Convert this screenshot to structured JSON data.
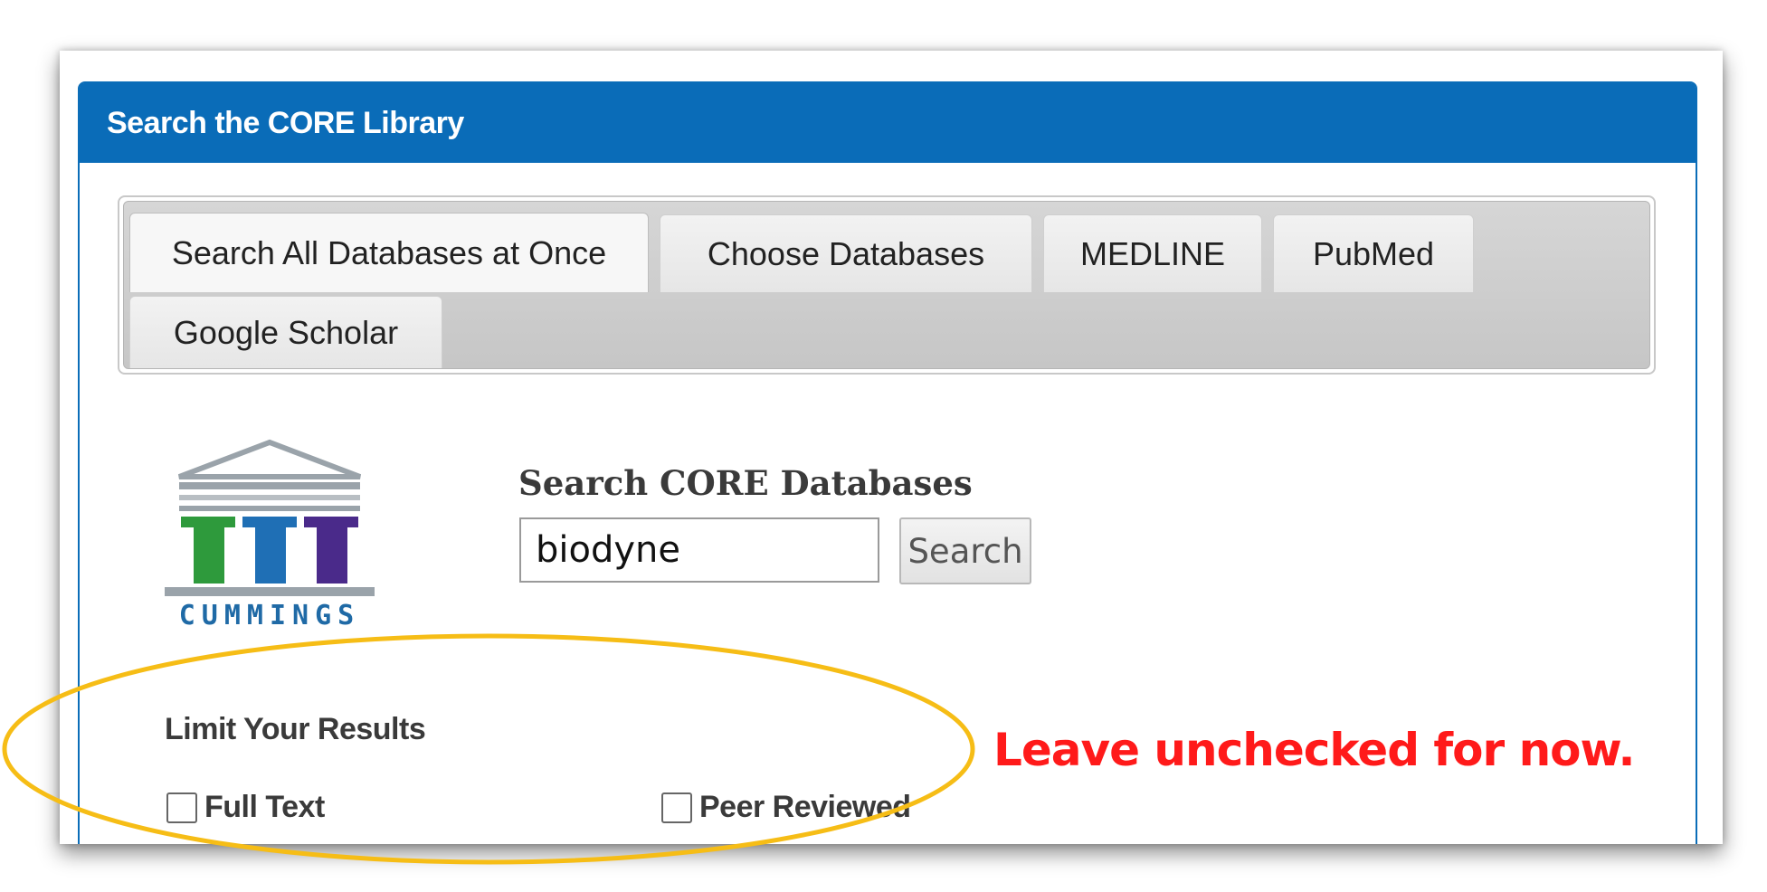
{
  "panel": {
    "title": "Search the CORE Library"
  },
  "tabs": [
    {
      "label": "Search All Databases at Once",
      "active": true
    },
    {
      "label": "Choose Databases",
      "active": false
    },
    {
      "label": "MEDLINE",
      "active": false
    },
    {
      "label": "PubMed",
      "active": false
    },
    {
      "label": "Google Scholar",
      "active": false
    }
  ],
  "logo": {
    "text": "CUMMINGS",
    "icon": "columns-icon",
    "colors": {
      "roof": "#9aa3aa",
      "column_1": "#2e9a3c",
      "column_2": "#1f6fb5",
      "column_3": "#4a2a8a",
      "text": "#1f6aa6"
    }
  },
  "search": {
    "label": "Search CORE Databases",
    "value": "biodyne",
    "button_label": "Search"
  },
  "limits": {
    "title": "Limit Your Results",
    "options": [
      {
        "label": "Full Text",
        "checked": false
      },
      {
        "label": "Peer Reviewed",
        "checked": false
      }
    ]
  },
  "annotation": {
    "text": "Leave unchecked for now.",
    "color": "#ff1a1a",
    "highlight_color": "#f6bd16"
  },
  "colors": {
    "header": "#0a6cb8"
  }
}
